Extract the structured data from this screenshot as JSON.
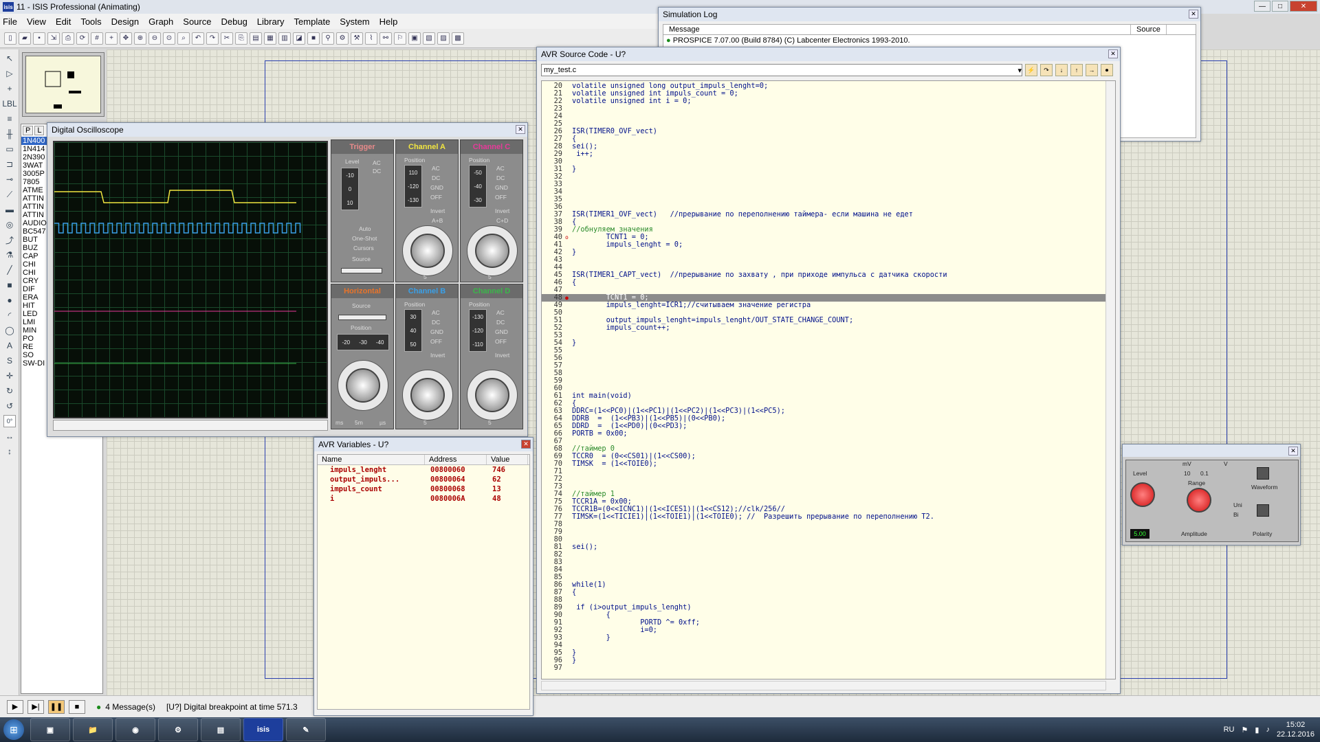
{
  "app": {
    "title": "11 - ISIS Professional (Animating)",
    "logo": "isis"
  },
  "menu": [
    "File",
    "View",
    "Edit",
    "Tools",
    "Design",
    "Graph",
    "Source",
    "Debug",
    "Library",
    "Template",
    "System",
    "Help"
  ],
  "device_list": {
    "tabs": [
      "P",
      "L"
    ],
    "items": [
      "1N400",
      "1N414",
      "2N390",
      "3WAT",
      "3005P",
      "7805",
      "ATME",
      "ATTIN",
      "ATTIN",
      "ATTIN",
      "AUDIO",
      "BC547",
      "BUT",
      "BUZ",
      "CAP",
      "CHI",
      "CHI",
      "CRY",
      "DIF",
      "ERA",
      "HIT",
      "LED",
      "LMI",
      "MIN",
      "PO",
      "RE",
      "SO",
      "SW-DI"
    ],
    "selected": 0
  },
  "angle": "0°",
  "sim_log": {
    "title": "Simulation Log",
    "cols": [
      "Message",
      "Source"
    ],
    "first_line": "PROSPICE 7.07.00 (Build 8784) (C) Labcenter Electronics 1993-2010."
  },
  "avr_source": {
    "title": "AVR Source Code - U?",
    "file": "my_test.c",
    "lines": [
      {
        "n": "20",
        "t": "volatile unsigned long output_impuls_lenght=0;"
      },
      {
        "n": "21",
        "t": "volatile unsigned int impuls_count = 0;"
      },
      {
        "n": "22",
        "t": "volatile unsigned int i = 0;"
      },
      {
        "n": "23",
        "t": ""
      },
      {
        "n": "24",
        "t": ""
      },
      {
        "n": "25",
        "t": ""
      },
      {
        "n": "26",
        "t": "ISR(TIMER0_OVF_vect)"
      },
      {
        "n": "27",
        "t": "{"
      },
      {
        "n": "28",
        "t": "sei();"
      },
      {
        "n": "29",
        "t": " i++;"
      },
      {
        "n": "30",
        "t": ""
      },
      {
        "n": "31",
        "t": "}"
      },
      {
        "n": "32",
        "t": ""
      },
      {
        "n": "33",
        "t": ""
      },
      {
        "n": "34",
        "t": ""
      },
      {
        "n": "35",
        "t": ""
      },
      {
        "n": "36",
        "t": ""
      },
      {
        "n": "37",
        "t": "ISR(TIMER1_OVF_vect)   //прерывание по переполнению таймера- если машина не едет"
      },
      {
        "n": "38",
        "t": "{"
      },
      {
        "n": "39",
        "t": "//обнуляем значения",
        "c": true
      },
      {
        "n": "40",
        "t": "        TCNT1 = 0;",
        "m": "o"
      },
      {
        "n": "41",
        "t": "        impuls_lenght = 0;"
      },
      {
        "n": "42",
        "t": "}"
      },
      {
        "n": "43",
        "t": ""
      },
      {
        "n": "44",
        "t": ""
      },
      {
        "n": "45",
        "t": "ISR(TIMER1_CAPT_vect)  //прерывание по захвату , при приходе импульса с датчика скорости"
      },
      {
        "n": "46",
        "t": "{"
      },
      {
        "n": "47",
        "t": ""
      },
      {
        "n": "48",
        "t": "        TCNT1 = 0;",
        "m": "●",
        "hl": true
      },
      {
        "n": "49",
        "t": "        impuls_lenght=ICR1;//считываем значение регистра"
      },
      {
        "n": "50",
        "t": ""
      },
      {
        "n": "51",
        "t": "        output_impuls_lenght=impuls_lenght/OUT_STATE_CHANGE_COUNT;"
      },
      {
        "n": "52",
        "t": "        impuls_count++;"
      },
      {
        "n": "53",
        "t": ""
      },
      {
        "n": "54",
        "t": "}"
      },
      {
        "n": "55",
        "t": ""
      },
      {
        "n": "56",
        "t": ""
      },
      {
        "n": "57",
        "t": ""
      },
      {
        "n": "58",
        "t": ""
      },
      {
        "n": "59",
        "t": ""
      },
      {
        "n": "60",
        "t": ""
      },
      {
        "n": "61",
        "t": "int main(void)"
      },
      {
        "n": "62",
        "t": "{"
      },
      {
        "n": "63",
        "t": "DDRC=(1<<PC0)|(1<<PC1)|(1<<PC2)|(1<<PC3)|(1<<PC5);"
      },
      {
        "n": "64",
        "t": "DDRB  =  (1<<PB3)|(1<<PB5)|(0<<PB0);"
      },
      {
        "n": "65",
        "t": "DDRD  =  (1<<PD0)|(0<<PD3);"
      },
      {
        "n": "66",
        "t": "PORTB = 0x00;"
      },
      {
        "n": "67",
        "t": ""
      },
      {
        "n": "68",
        "t": "//таймер 0",
        "c": true
      },
      {
        "n": "69",
        "t": "TCCR0  = (0<<CS01)|(1<<CS00);"
      },
      {
        "n": "70",
        "t": "TIMSK  = (1<<TOIE0);"
      },
      {
        "n": "71",
        "t": ""
      },
      {
        "n": "72",
        "t": ""
      },
      {
        "n": "73",
        "t": ""
      },
      {
        "n": "74",
        "t": "//таймер 1",
        "c": true
      },
      {
        "n": "75",
        "t": "TCCR1A = 0x00;"
      },
      {
        "n": "76",
        "t": "TCCR1B=(0<<ICNC1)|(1<<ICES1)|(1<<CS12);//clk/256//"
      },
      {
        "n": "77",
        "t": "TIMSK=(1<<TICIE1)|(1<<TOIE1)|(1<<TOIE0); //  Разрешить прерывание по переполнению T2."
      },
      {
        "n": "78",
        "t": ""
      },
      {
        "n": "79",
        "t": ""
      },
      {
        "n": "80",
        "t": ""
      },
      {
        "n": "81",
        "t": "sei();"
      },
      {
        "n": "82",
        "t": ""
      },
      {
        "n": "83",
        "t": ""
      },
      {
        "n": "84",
        "t": ""
      },
      {
        "n": "85",
        "t": ""
      },
      {
        "n": "86",
        "t": "while(1)"
      },
      {
        "n": "87",
        "t": "{"
      },
      {
        "n": "88",
        "t": ""
      },
      {
        "n": "89",
        "t": " if (i>output_impuls_lenght)"
      },
      {
        "n": "90",
        "t": "        {"
      },
      {
        "n": "91",
        "t": "                PORTD ^= 0xff;"
      },
      {
        "n": "92",
        "t": "                i=0;"
      },
      {
        "n": "93",
        "t": "        }"
      },
      {
        "n": "94",
        "t": ""
      },
      {
        "n": "95",
        "t": "}"
      },
      {
        "n": "96",
        "t": "}"
      },
      {
        "n": "97",
        "t": ""
      }
    ]
  },
  "osc": {
    "title": "Digital Oscilloscope",
    "trigger": "Trigger",
    "chA": "Channel A",
    "chB": "Channel B",
    "chC": "Channel C",
    "chD": "Channel D",
    "horizontal": "Horizontal",
    "level": "Level",
    "auto": "Auto",
    "one_shot": "One-Shot",
    "cursors": "Cursors",
    "source": "Source",
    "position": "Position",
    "invert": "Invert",
    "ab": "A+B",
    "cd": "C+D",
    "ac": "AC",
    "dc": "DC",
    "gnd": "GND",
    "off": "OFF",
    "ms": "ms",
    "us": "µs",
    "mv": "mV",
    "v": "V",
    "val5": "5",
    "val5m": "5m",
    "colors": {
      "trigger": "#e88a8a",
      "chA": "#f2e640",
      "chB": "#3aa0e8",
      "chC": "#e83a9a",
      "chD": "#3ab84a",
      "horizontal": "#e8742a"
    }
  },
  "vars": {
    "title": "AVR Variables - U?",
    "cols": [
      "Name",
      "Address",
      "Value"
    ],
    "rows": [
      {
        "name": "impuls_lenght",
        "addr": "00800060",
        "val": "746"
      },
      {
        "name": "output_impuls...",
        "addr": "00800064",
        "val": "62"
      },
      {
        "name": "impuls_count",
        "addr": "00800068",
        "val": "13"
      },
      {
        "name": "i",
        "addr": "0080006A",
        "val": "48"
      }
    ]
  },
  "gen": {
    "level": "Level",
    "range": "Range",
    "amplitude": "Amplitude",
    "waveform": "Waveform",
    "polarity": "Polarity",
    "uni": "Uni",
    "bi": "Bi",
    "mv": "mV",
    "v": "V",
    "r10": "10",
    "r01": "0.1",
    "readout": "5.00"
  },
  "status": {
    "messages": "4 Message(s)",
    "text": "[U?] Digital breakpoint at time 571.3"
  },
  "tray": {
    "lang": "RU",
    "time": "15:02",
    "date": "22.12.2016"
  }
}
